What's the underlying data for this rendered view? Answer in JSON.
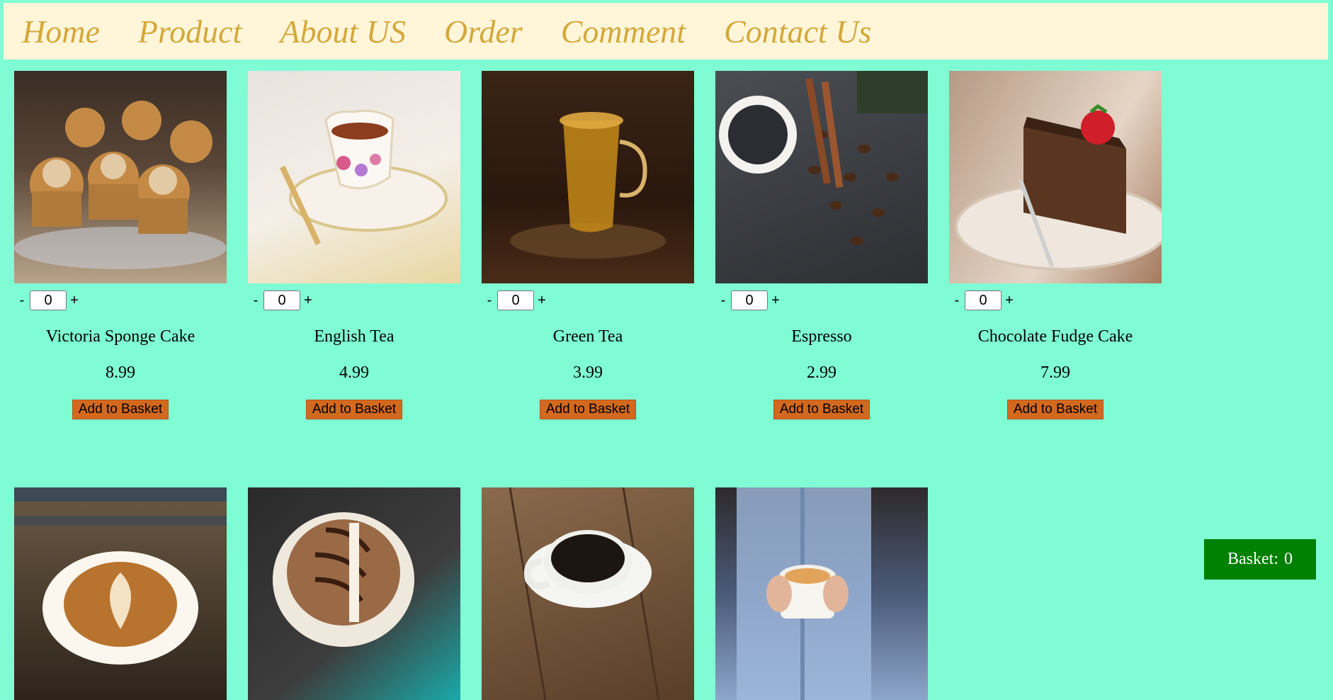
{
  "nav": [
    "Home",
    "Product",
    "About US",
    "Order",
    "Comment",
    "Contact Us"
  ],
  "products": [
    {
      "name": "Victoria Sponge Cake",
      "price": "8.99",
      "qty": "0",
      "image": "muffins-on-glass-stand"
    },
    {
      "name": "English Tea",
      "price": "4.99",
      "qty": "0",
      "image": "floral-teacup"
    },
    {
      "name": "Green Tea",
      "price": "3.99",
      "qty": "0",
      "image": "glass-tea-cup"
    },
    {
      "name": "Espresso",
      "price": "2.99",
      "qty": "0",
      "image": "espresso-with-beans"
    },
    {
      "name": "Chocolate Fudge Cake",
      "price": "7.99",
      "qty": "0",
      "image": "chocolate-cake-slice"
    }
  ],
  "row2_images": [
    "latte-art",
    "cappuccino",
    "black-coffee",
    "hands-holding-cup"
  ],
  "qty_labels": {
    "minus": "-",
    "plus": "+"
  },
  "add_label": "Add to Basket",
  "basket": {
    "label": "Basket:",
    "count": "0"
  },
  "colors": {
    "background": "#7ffcd4",
    "nav": "#fff6da",
    "nav_text": "#d4a83a",
    "button": "#d2691e",
    "basket": "#008000"
  }
}
